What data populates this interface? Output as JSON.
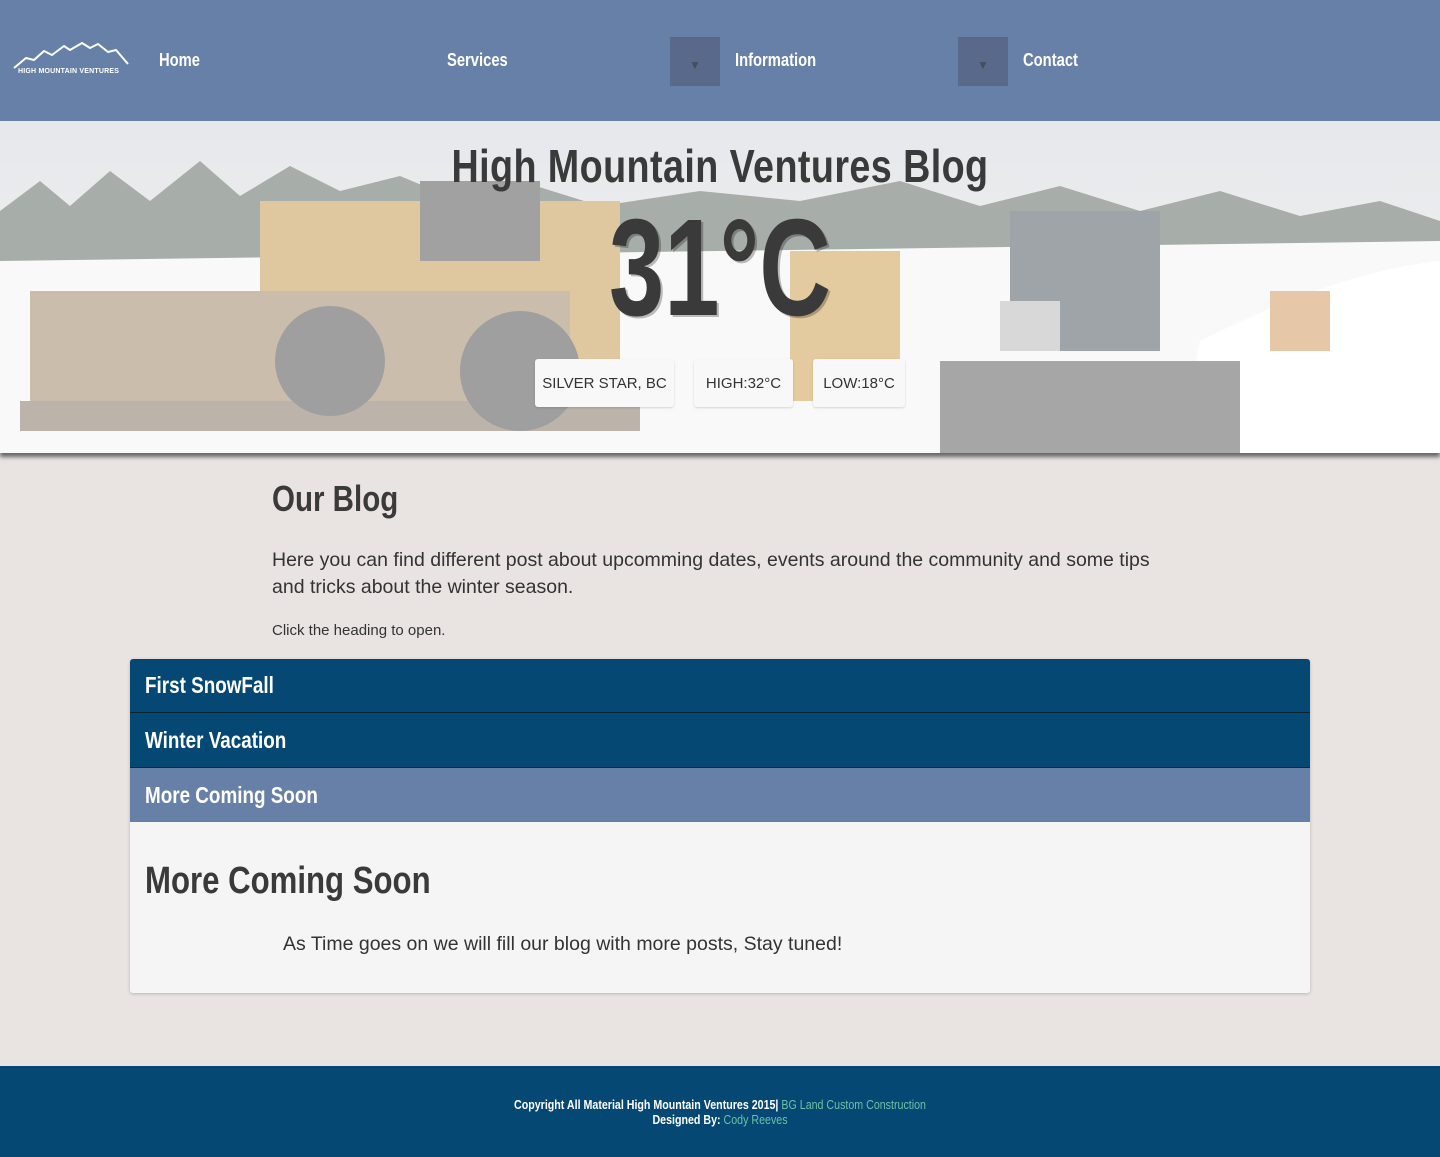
{
  "nav": {
    "logo_text": "HIGH MOUNTAIN VENTURES",
    "links": [
      "Home",
      "Services",
      "Information",
      "Contact"
    ],
    "toggle_glyph": "▼"
  },
  "hero": {
    "title": "High Mountain Ventures Blog",
    "temperature": "31°C",
    "location": "SILVER STAR, BC",
    "high": "HIGH:32°C",
    "low": "LOW:18°C"
  },
  "blog": {
    "title": "Our Blog",
    "intro": "Here you can find different post about upcomming dates, events around the community and some tips and tricks about the winter season.",
    "hint": "Click the heading to open."
  },
  "accordion": {
    "items": [
      "First SnowFall",
      "Winter Vacation",
      "More Coming Soon"
    ],
    "active_index": 2,
    "panel_title": "More Coming Soon",
    "panel_text": "As Time goes on we will fill our blog with more posts, Stay tuned!"
  },
  "footer": {
    "copyright": "Copyright All Material High Mountain Ventures 2015|",
    "company_link": "BG Land Custom Construction",
    "designed_by": "Designed By:",
    "designer_link": "Cody Reeves"
  },
  "colors": {
    "nav_bg": "#6680a8",
    "accent_dark": "#054874",
    "page_bg": "#e9e3e2",
    "footer_link": "#6cc0a6"
  }
}
